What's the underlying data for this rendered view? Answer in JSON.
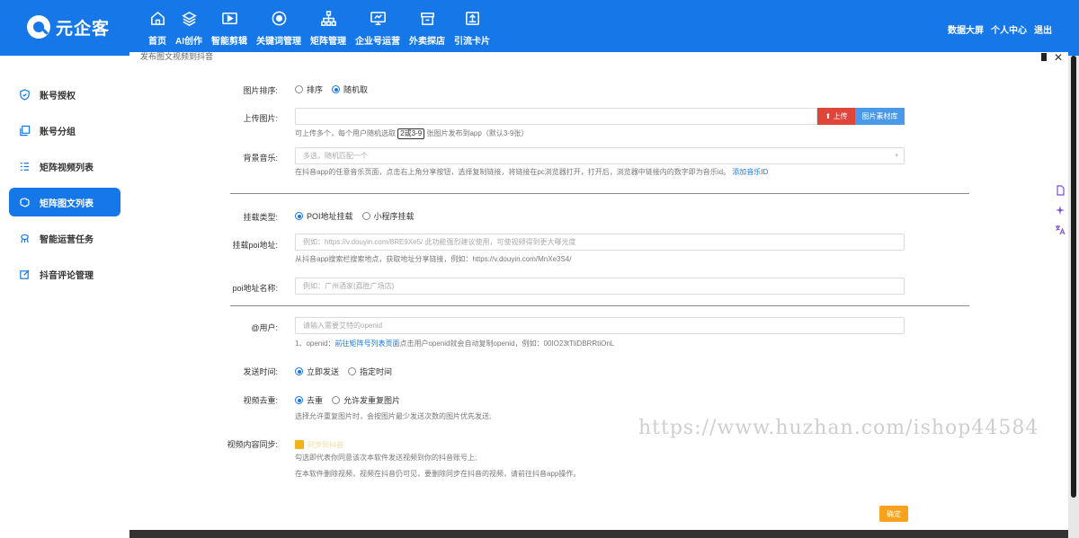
{
  "brand": {
    "name": "元企客"
  },
  "nav": [
    {
      "label": "首页",
      "icon": "home-icon"
    },
    {
      "label": "AI创作",
      "icon": "layers-icon"
    },
    {
      "label": "智能剪辑",
      "icon": "video-icon"
    },
    {
      "label": "关键词管理",
      "icon": "target-icon"
    },
    {
      "label": "矩阵管理",
      "icon": "hierarchy-icon"
    },
    {
      "label": "企业号运营",
      "icon": "monitor-icon"
    },
    {
      "label": "外卖探店",
      "icon": "store-icon"
    },
    {
      "label": "引流卡片",
      "icon": "upload-box-icon"
    }
  ],
  "top_right": {
    "dashboard": "数据大屏",
    "user_center": "个人中心",
    "logout": "退出"
  },
  "sidebar": [
    {
      "label": "账号授权",
      "icon": "shield-icon",
      "active": false
    },
    {
      "label": "账号分组",
      "icon": "copy-icon",
      "active": false
    },
    {
      "label": "矩阵视频列表",
      "icon": "list-icon",
      "active": false
    },
    {
      "label": "矩阵图文列表",
      "icon": "brain-icon",
      "active": true
    },
    {
      "label": "智能运营任务",
      "icon": "task-icon",
      "active": false
    },
    {
      "label": "抖音评论管理",
      "icon": "edit-icon",
      "active": false
    }
  ],
  "modal": {
    "title": "发布图文视频到抖音",
    "sort": {
      "label": "图片排序:",
      "options": [
        "排序",
        "随机取"
      ],
      "selected": 1
    },
    "upload": {
      "label": "上传图片:",
      "upload_btn": "上传",
      "library_btn": "图片素材库",
      "hint_before": "可上传多个，每个用户随机选取",
      "hint_value": "2或3-9",
      "hint_after": "张图片发布到app（默认3-9张）"
    },
    "music": {
      "label": "背景音乐:",
      "placeholder": "多选，随机匹配一个",
      "hint": "在抖音app的任意音乐页面，点击右上角分享按钮，选择复制链接，将链接在pc浏览器打开，打开后，浏览器中链接内的数字即为音乐id。",
      "hint_link": "添加音乐ID"
    },
    "mount_type": {
      "label": "挂载类型:",
      "options": [
        "POI地址挂载",
        "小程序挂载"
      ],
      "selected": 0
    },
    "poi_url": {
      "label": "挂载poi地址:",
      "placeholder": "例如：https://v.douyin.com/8RE9Xe5/ 此功能强烈建议使用，可使视频得到更大曝光度",
      "hint": "从抖音app搜索栏搜索地点，获取地址分享链接，例如：https://v.douyin.com/MnXe3S4/"
    },
    "poi_name": {
      "label": "poi地址名称:",
      "placeholder": "例如：广州酒家(荔胜广场店)"
    },
    "at_user": {
      "label": "@用户:",
      "placeholder": "请输入需要艾特的openid",
      "hint_before": "1、openid：",
      "hint_link": "前往矩阵号列表页面",
      "hint_after": "点击用户openid就会自动复制openid，例如：00IO23tTliDBRRtiOnL"
    },
    "send_time": {
      "label": "发送时间:",
      "options": [
        "立即发送",
        "指定时间"
      ],
      "selected": 0
    },
    "dedupe": {
      "label": "视频去重:",
      "options": [
        "去重",
        "允许发重复图片"
      ],
      "selected": 0,
      "hint": "选择允许重复图片时，会按图片最少发送次数的图片优先发送;"
    },
    "sync": {
      "label": "视频内容同步:",
      "checkbox_label": "同步到抖音",
      "checked": true,
      "hint1": "勾选即代表你同意该次本软件发送视频到你的抖音账号上;",
      "hint2": "在本软件删除视频，视频在抖音仍可见，要删除同步在抖音的视频，请前往抖音app操作。"
    },
    "confirm": "确定"
  },
  "watermark": "https://www.huzhan.com/ishop44584",
  "colors": {
    "primary": "#1677e8",
    "danger": "#e0453a",
    "warning": "#f7a21c"
  }
}
